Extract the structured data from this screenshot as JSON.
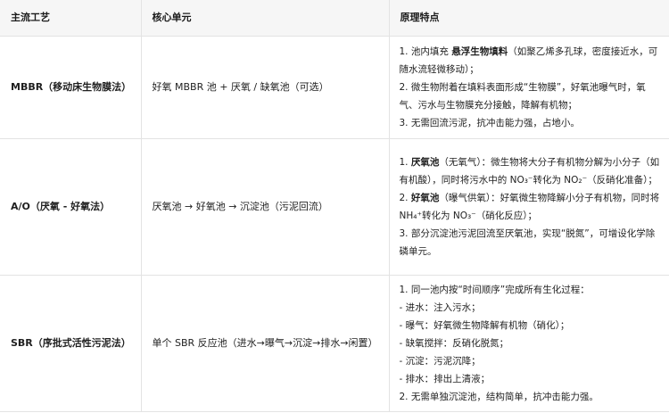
{
  "table": {
    "headers": [
      "主流工艺",
      "核心单元",
      "原理特点"
    ],
    "rows": [
      {
        "method": "MBBR（移动床生物膜法）",
        "unit": "好氧 MBBR 池 + 厌氧 / 缺氧池（可选）",
        "lines": [
          [
            "1. 池内填充 ",
            "悬浮生物填料",
            "（如聚乙烯多孔球，密度接近水，可随水流轻微移动）；"
          ],
          [
            "2. 微生物附着在填料表面形成“生物膜”，好氧池曝气时，氧气、污水与生物膜充分接触，降解有机物；"
          ],
          [
            "3. 无需回流污泥，抗冲击能力强，占地小。"
          ]
        ]
      },
      {
        "method": "A/O（厌氧 - 好氧法）",
        "unit": "厌氧池 → 好氧池 → 沉淀池（污泥回流）",
        "lines": [
          [
            "1. ",
            "厌氧池",
            "（无氧气）：微生物将大分子有机物分解为小分子（如有机酸），同时将污水中的 NO₃⁻转化为 NO₂⁻（反硝化准备）；"
          ],
          [
            "2. ",
            "好氧池",
            "（曝气供氧）：好氧微生物降解小分子有机物，同时将 NH₄⁺转化为 NO₃⁻（硝化反应）；"
          ],
          [
            "3. 部分沉淀池污泥回流至厌氧池，实现“脱氮”，可增设化学除磷单元。"
          ]
        ]
      },
      {
        "method": "SBR（序批式活性污泥法）",
        "unit": "单个 SBR 反应池（进水→曝气→沉淀→排水→闲置）",
        "lines": [
          [
            "1. 同一池内按“时间顺序”完成所有生化过程："
          ],
          [
            "- 进水：注入污水；"
          ],
          [
            "- 曝气：好氧微生物降解有机物（硝化）；"
          ],
          [
            "- 缺氧搅拌：反硝化脱氮；"
          ],
          [
            "- 沉淀：污泥沉降；"
          ],
          [
            "- 排水：排出上清液；"
          ],
          [
            "2. 无需单独沉淀池，结构简单，抗冲击能力强。"
          ]
        ]
      }
    ]
  }
}
